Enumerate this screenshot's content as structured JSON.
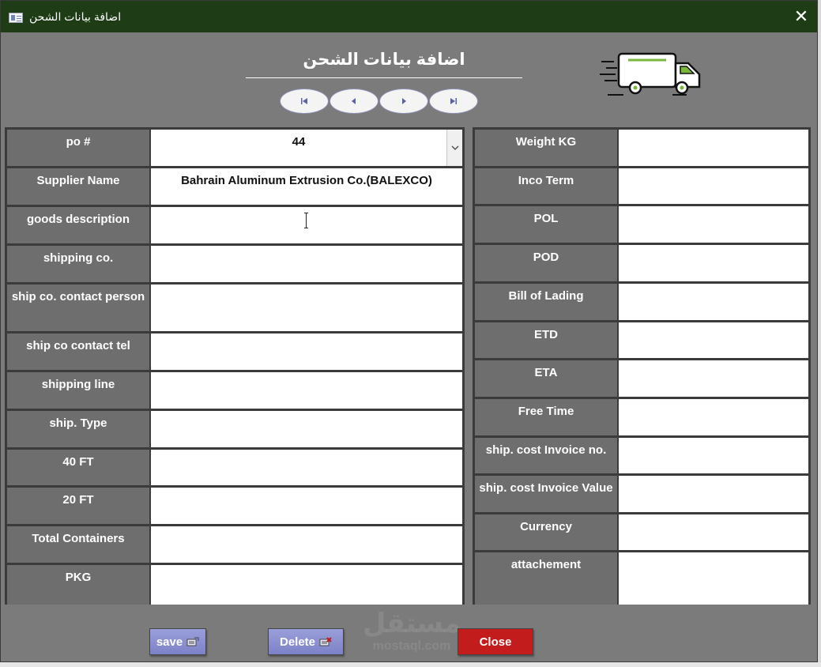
{
  "window": {
    "title": "اضافة بيانات الشحن",
    "close_glyph": "✕"
  },
  "header": {
    "title": "اضافة بيانات الشحن"
  },
  "nav": {
    "buttons": [
      "first-record",
      "previous-record",
      "next-record",
      "last-record"
    ]
  },
  "left_fields": [
    {
      "label": "po #",
      "value": "44"
    },
    {
      "label": "Supplier Name",
      "value": "Bahrain Aluminum Extrusion Co.(BALEXCO)"
    },
    {
      "label": "goods description",
      "value": ""
    },
    {
      "label": "shipping co.",
      "value": ""
    },
    {
      "label": "ship co. contact person",
      "value": ""
    },
    {
      "label": "ship co contact tel",
      "value": ""
    },
    {
      "label": "shipping line",
      "value": ""
    },
    {
      "label": "ship. Type",
      "value": ""
    },
    {
      "label": "40 FT",
      "value": ""
    },
    {
      "label": "20 FT",
      "value": ""
    },
    {
      "label": "Total Containers",
      "value": ""
    },
    {
      "label": "PKG",
      "value": ""
    }
  ],
  "right_fields": [
    {
      "label": "Weight KG",
      "value": ""
    },
    {
      "label": "Inco Term",
      "value": ""
    },
    {
      "label": "POL",
      "value": ""
    },
    {
      "label": "POD",
      "value": ""
    },
    {
      "label": "Bill of Lading",
      "value": ""
    },
    {
      "label": "ETD",
      "value": ""
    },
    {
      "label": "ETA",
      "value": ""
    },
    {
      "label": "Free Time",
      "value": ""
    },
    {
      "label": "ship. cost Invoice no.",
      "value": ""
    },
    {
      "label": "ship. cost Invoice Value",
      "value": ""
    },
    {
      "label": "Currency",
      "value": ""
    },
    {
      "label": "attachement",
      "value": ""
    }
  ],
  "buttons": {
    "save": "save",
    "delete": "Delete",
    "close": "Close"
  },
  "watermark": {
    "arabic": "مستقل",
    "latin": "mostaql.com"
  },
  "colors": {
    "titlebar": "#1e3d17",
    "body": "#7b7b7b",
    "label_bg": "#6e6e6e",
    "save_delete": "#8a90d0",
    "close": "#c21c1c",
    "truck_accent": "#7ab83c"
  }
}
